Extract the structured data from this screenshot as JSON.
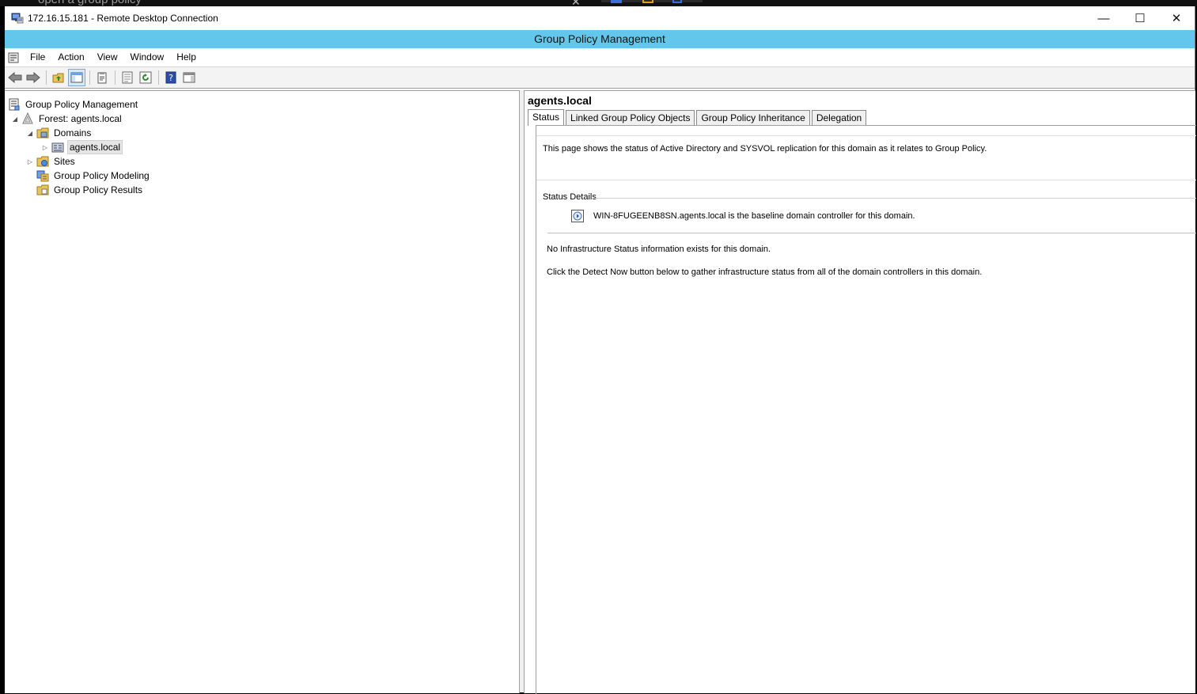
{
  "background_tab": {
    "search_text": "open a group policy"
  },
  "rdp": {
    "title": "172.16.15.181 - Remote Desktop Connection",
    "minimize": "—",
    "maximize": "☐",
    "close": "✕"
  },
  "app": {
    "title": "Group Policy Management",
    "menu": [
      "File",
      "Action",
      "View",
      "Window",
      "Help"
    ]
  },
  "tree": {
    "root": "Group Policy Management",
    "forest": "Forest: agents.local",
    "domains": "Domains",
    "domain": "agents.local",
    "sites": "Sites",
    "modeling": "Group Policy Modeling",
    "results": "Group Policy Results"
  },
  "detail": {
    "title": "agents.local",
    "tabs": [
      "Status",
      "Linked Group Policy Objects",
      "Group Policy Inheritance",
      "Delegation"
    ],
    "intro": "This page shows the status of Active Directory and SYSVOL replication for this domain as it relates to Group Policy.",
    "status_heading": "Status Details",
    "baseline": "WIN-8FUGEENB8SN.agents.local is the baseline domain controller for this domain.",
    "no_infra": "No Infrastructure Status information exists for this domain.",
    "detect_hint": "Click the Detect Now button below to gather infrastructure status from all of the domain controllers in this domain."
  },
  "colors": {
    "title_bar": "#63c7ec"
  }
}
